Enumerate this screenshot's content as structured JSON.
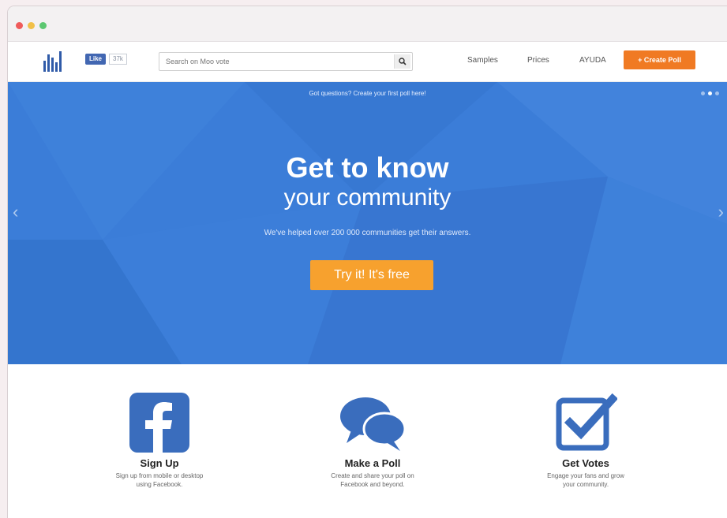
{
  "window": {
    "controls": [
      "close",
      "minimize",
      "maximize"
    ]
  },
  "navbar": {
    "fb_like": {
      "label": "Like",
      "count": "37k"
    },
    "search": {
      "placeholder": "Search on Moo vote"
    },
    "links": [
      "Samples",
      "Prices",
      "AYUDA"
    ],
    "create_button": "+ Create Poll"
  },
  "hero": {
    "tagline": "Got questions? Create your first poll here!",
    "heading_bold": "Get to know",
    "heading_light": "your community",
    "subtitle": "We've helped over 200 000 communities get their answers.",
    "cta": "Try it! It's free"
  },
  "features": [
    {
      "icon": "facebook-icon",
      "title": "Sign Up",
      "desc_line1": "Sign up from mobile or desktop",
      "desc_line2": "using Facebook."
    },
    {
      "icon": "chat-bubbles-icon",
      "title": "Make a Poll",
      "desc_line1": "Create and share your poll on",
      "desc_line2": "Facebook and beyond."
    },
    {
      "icon": "checkbox-icon",
      "title": "Get Votes",
      "desc_line1": "Engage your fans and grow",
      "desc_line2": "your community."
    }
  ],
  "colors": {
    "brand_blue": "#3b7dd8",
    "cta_orange": "#f7a12e",
    "create_orange": "#f07a23",
    "icon_blue": "#3a6dbd"
  }
}
